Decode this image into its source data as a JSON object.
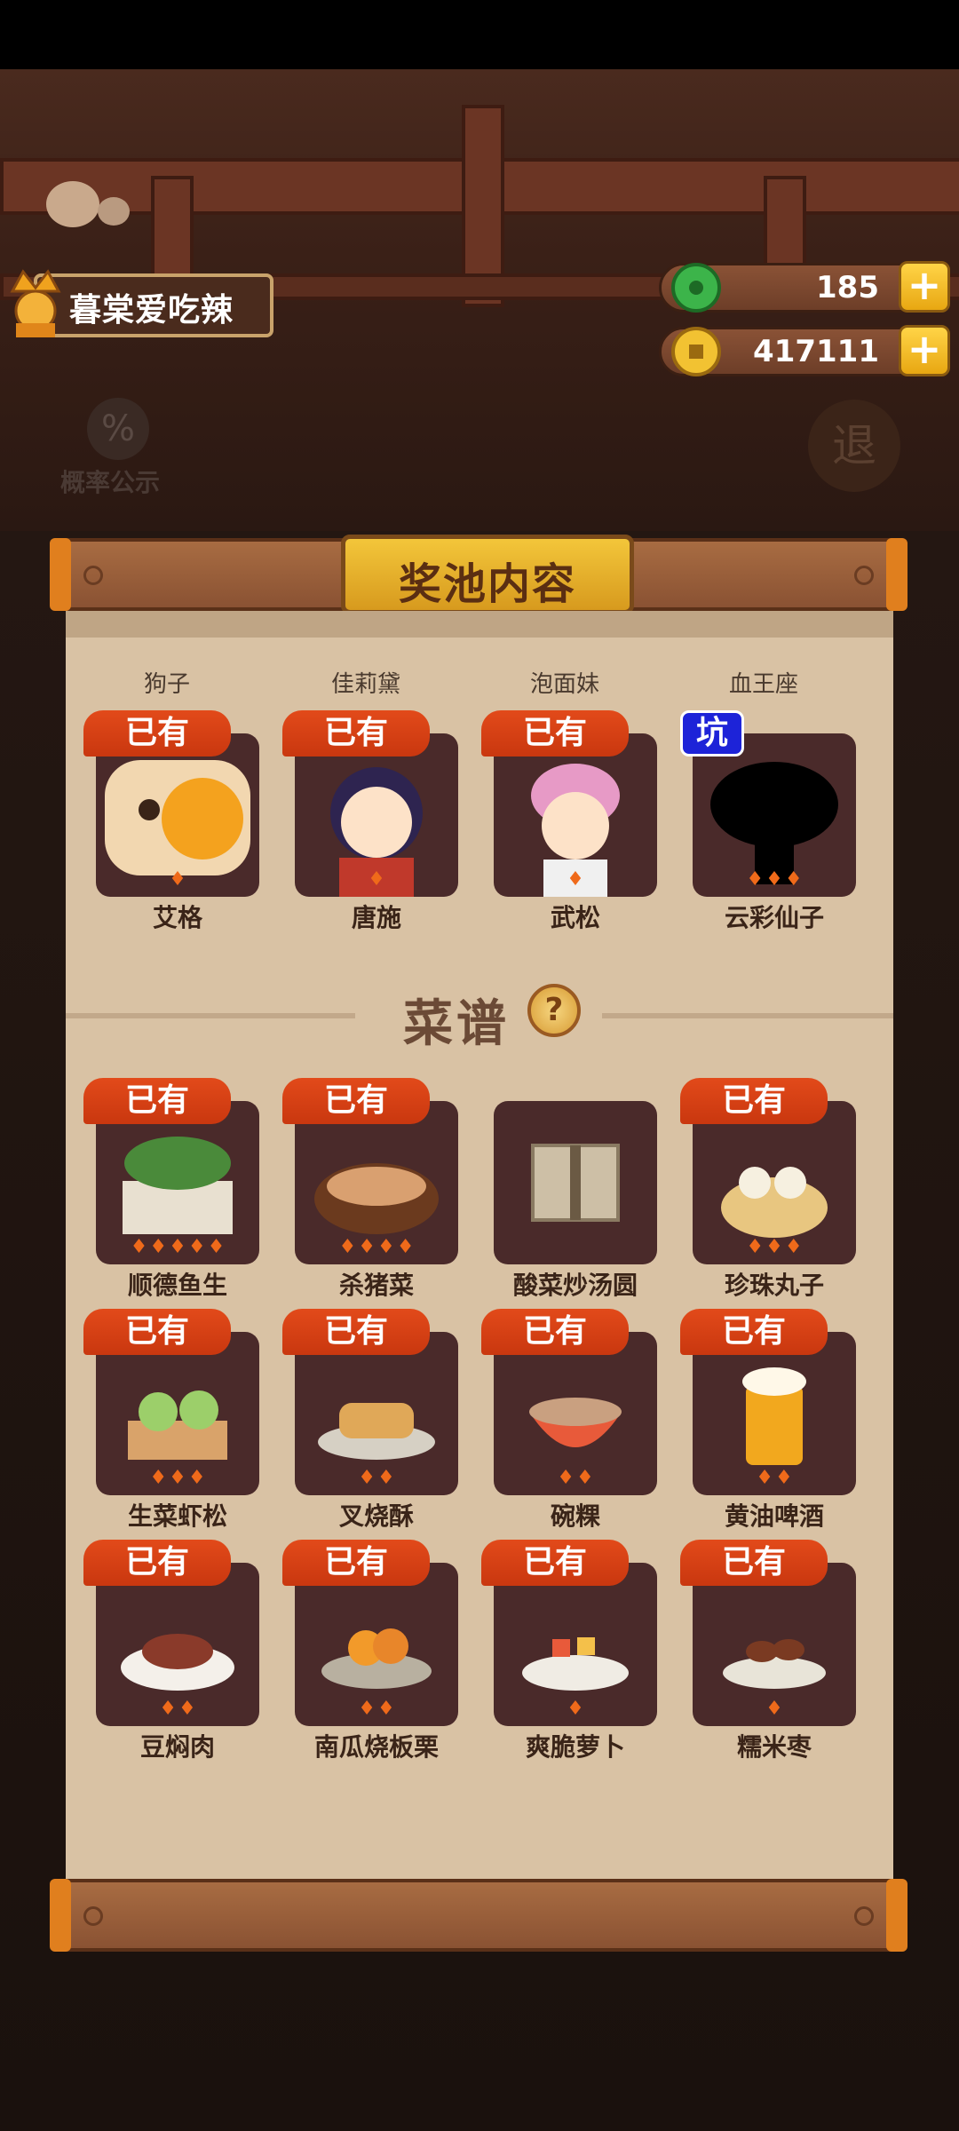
{
  "player": {
    "name": "暮棠爱吃辣"
  },
  "currency": {
    "jade": "185",
    "coins": "417111"
  },
  "background": {
    "probability_label": "概率公示",
    "exit_label": "退"
  },
  "modal": {
    "title": "奖池内容"
  },
  "characters": [
    {
      "top_label": "狗子",
      "name": "艾格",
      "badge": "已有",
      "flames": 1
    },
    {
      "top_label": "佳莉黛",
      "name": "唐施",
      "badge": "已有",
      "flames": 1
    },
    {
      "top_label": "泡面妹",
      "name": "武松",
      "badge": "已有",
      "flames": 1
    },
    {
      "top_label": "血王座",
      "name": "云彩仙子",
      "badge": "坑",
      "flames": 3
    }
  ],
  "recipes_section": {
    "title": "菜谱",
    "help": "?"
  },
  "recipes": [
    {
      "name": "顺德鱼生",
      "badge": "已有",
      "flames": 5
    },
    {
      "name": "杀猪菜",
      "badge": "已有",
      "flames": 4
    },
    {
      "name": "酸菜炒汤圆",
      "badge": "",
      "flames": 0
    },
    {
      "name": "珍珠丸子",
      "badge": "已有",
      "flames": 3
    },
    {
      "name": "生菜虾松",
      "badge": "已有",
      "flames": 3
    },
    {
      "name": "叉烧酥",
      "badge": "已有",
      "flames": 2
    },
    {
      "name": "碗粿",
      "badge": "已有",
      "flames": 2
    },
    {
      "name": "黄油啤酒",
      "badge": "已有",
      "flames": 2
    },
    {
      "name": "豆焖肉",
      "badge": "已有",
      "flames": 2
    },
    {
      "name": "南瓜烧板栗",
      "badge": "已有",
      "flames": 2
    },
    {
      "name": "爽脆萝卜",
      "badge": "已有",
      "flames": 1
    },
    {
      "name": "糯米枣",
      "badge": "已有",
      "flames": 1
    }
  ]
}
